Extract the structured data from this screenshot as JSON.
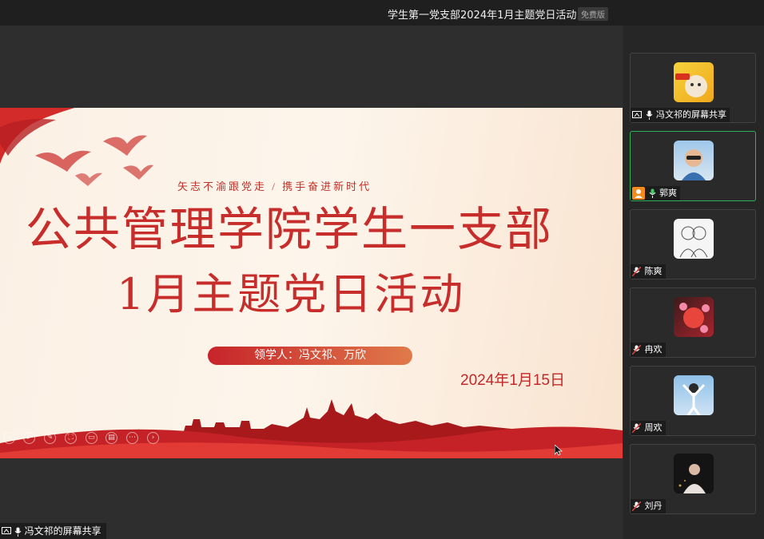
{
  "window": {
    "title": "学生第一党支部2024年1月主题党日活动",
    "edition_badge": "免费版"
  },
  "slide": {
    "tagline": "矢志不渝跟党走  /  携手奋进新时代",
    "title_line1": "公共管理学院学生一支部",
    "title_line2": "1月主题党日活动",
    "lead": "领学人：冯文祁、万欣",
    "date": "2024年1月15日",
    "tools": [
      "prev-icon",
      "play-icon",
      "pen-icon",
      "fullscreen-icon",
      "screen-icon",
      "comment-icon",
      "more-icon",
      "next-icon"
    ]
  },
  "share_bar": {
    "label": "冯文祁的屏幕共享"
  },
  "participants": [
    {
      "name": "冯文祁的屏幕共享",
      "icon": "mic-icon",
      "sharing": true
    },
    {
      "name": "郭爽",
      "icon": "mic-icon",
      "host": true,
      "active": true
    },
    {
      "name": "陈爽",
      "icon": "mic-muted-icon"
    },
    {
      "name": "冉欢",
      "icon": "mic-muted-icon"
    },
    {
      "name": "周欢",
      "icon": "mic-muted-icon"
    },
    {
      "name": "刘丹",
      "icon": "mic-muted-icon"
    }
  ],
  "colors": {
    "accent_red": "#c72d2b",
    "active_border": "#2fb35a",
    "host_orange": "#f28a1c"
  }
}
